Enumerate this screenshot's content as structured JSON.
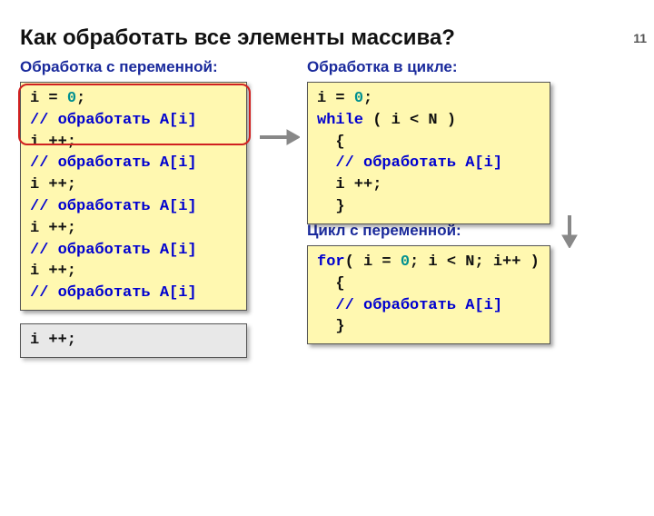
{
  "slide_number": "11",
  "title": "Как обработать все элементы массива?",
  "labels": {
    "left": "Обработка с переменной:",
    "right": "Обработка в цикле:",
    "cycle": "Цикл с переменной:"
  },
  "code": {
    "left_main": [
      {
        "t": "i",
        "c": "black"
      },
      {
        "t": " = ",
        "c": "black"
      },
      {
        "t": "0",
        "c": "teal"
      },
      {
        "t": ";\n",
        "c": "black"
      },
      {
        "t": "// обработать A[i]\n",
        "c": "blue"
      },
      {
        "t": "i ++;\n",
        "c": "black"
      },
      {
        "t": "// обработать A[i]\n",
        "c": "blue"
      },
      {
        "t": "i ++;\n",
        "c": "black"
      },
      {
        "t": "// обработать A[i]\n",
        "c": "blue"
      },
      {
        "t": "i ++;\n",
        "c": "black"
      },
      {
        "t": "// обработать A[i]\n",
        "c": "blue"
      },
      {
        "t": "i ++;\n",
        "c": "black"
      },
      {
        "t": "// обработать A[i]",
        "c": "blue"
      }
    ],
    "left_sub": [
      {
        "t": "i ++;",
        "c": "black"
      }
    ],
    "right_top": [
      {
        "t": "i",
        "c": "black"
      },
      {
        "t": " = ",
        "c": "black"
      },
      {
        "t": "0",
        "c": "teal"
      },
      {
        "t": ";\n",
        "c": "black"
      },
      {
        "t": "while",
        "c": "blue"
      },
      {
        "t": " ( i < N )\n",
        "c": "black"
      },
      {
        "t": "  {\n",
        "c": "black"
      },
      {
        "t": "  ",
        "c": "black"
      },
      {
        "t": "// обработать A[i]\n",
        "c": "blue"
      },
      {
        "t": "  i ++;\n",
        "c": "black"
      },
      {
        "t": "  }",
        "c": "black"
      }
    ],
    "right_bot": [
      {
        "t": "for",
        "c": "blue"
      },
      {
        "t": "( i = ",
        "c": "black"
      },
      {
        "t": "0",
        "c": "teal"
      },
      {
        "t": "; i < N; i++ )\n",
        "c": "black"
      },
      {
        "t": "  {\n",
        "c": "black"
      },
      {
        "t": "  ",
        "c": "black"
      },
      {
        "t": "// обработать A[i]\n",
        "c": "blue"
      },
      {
        "t": "  }",
        "c": "black"
      }
    ]
  },
  "chart_data": {
    "type": "table",
    "title": "Как обработать все элементы массива?",
    "blocks": [
      {
        "label": "Обработка с переменной:",
        "code": "i = 0;\n// обработать A[i]\ni ++;\n// обработать A[i]\ni ++;\n// обработать A[i]\ni ++;\n// обработать A[i]\ni ++;\n// обработать A[i]",
        "trailing": "i ++;"
      },
      {
        "label": "Обработка в цикле:",
        "code": "i = 0;\nwhile ( i < N )\n  {\n  // обработать A[i]\n  i ++;\n  }"
      },
      {
        "label": "Цикл с переменной:",
        "code": "for( i = 0; i < N; i++ )\n  {\n  // обработать A[i]\n  }"
      }
    ],
    "arrows": [
      {
        "from": "Обработка с переменной",
        "to": "Обработка в цикле",
        "dir": "right"
      },
      {
        "from": "Обработка в цикле",
        "to": "Цикл с переменной",
        "dir": "down"
      }
    ],
    "highlight": "Первые три строки левого блока обведены красной рамкой"
  }
}
